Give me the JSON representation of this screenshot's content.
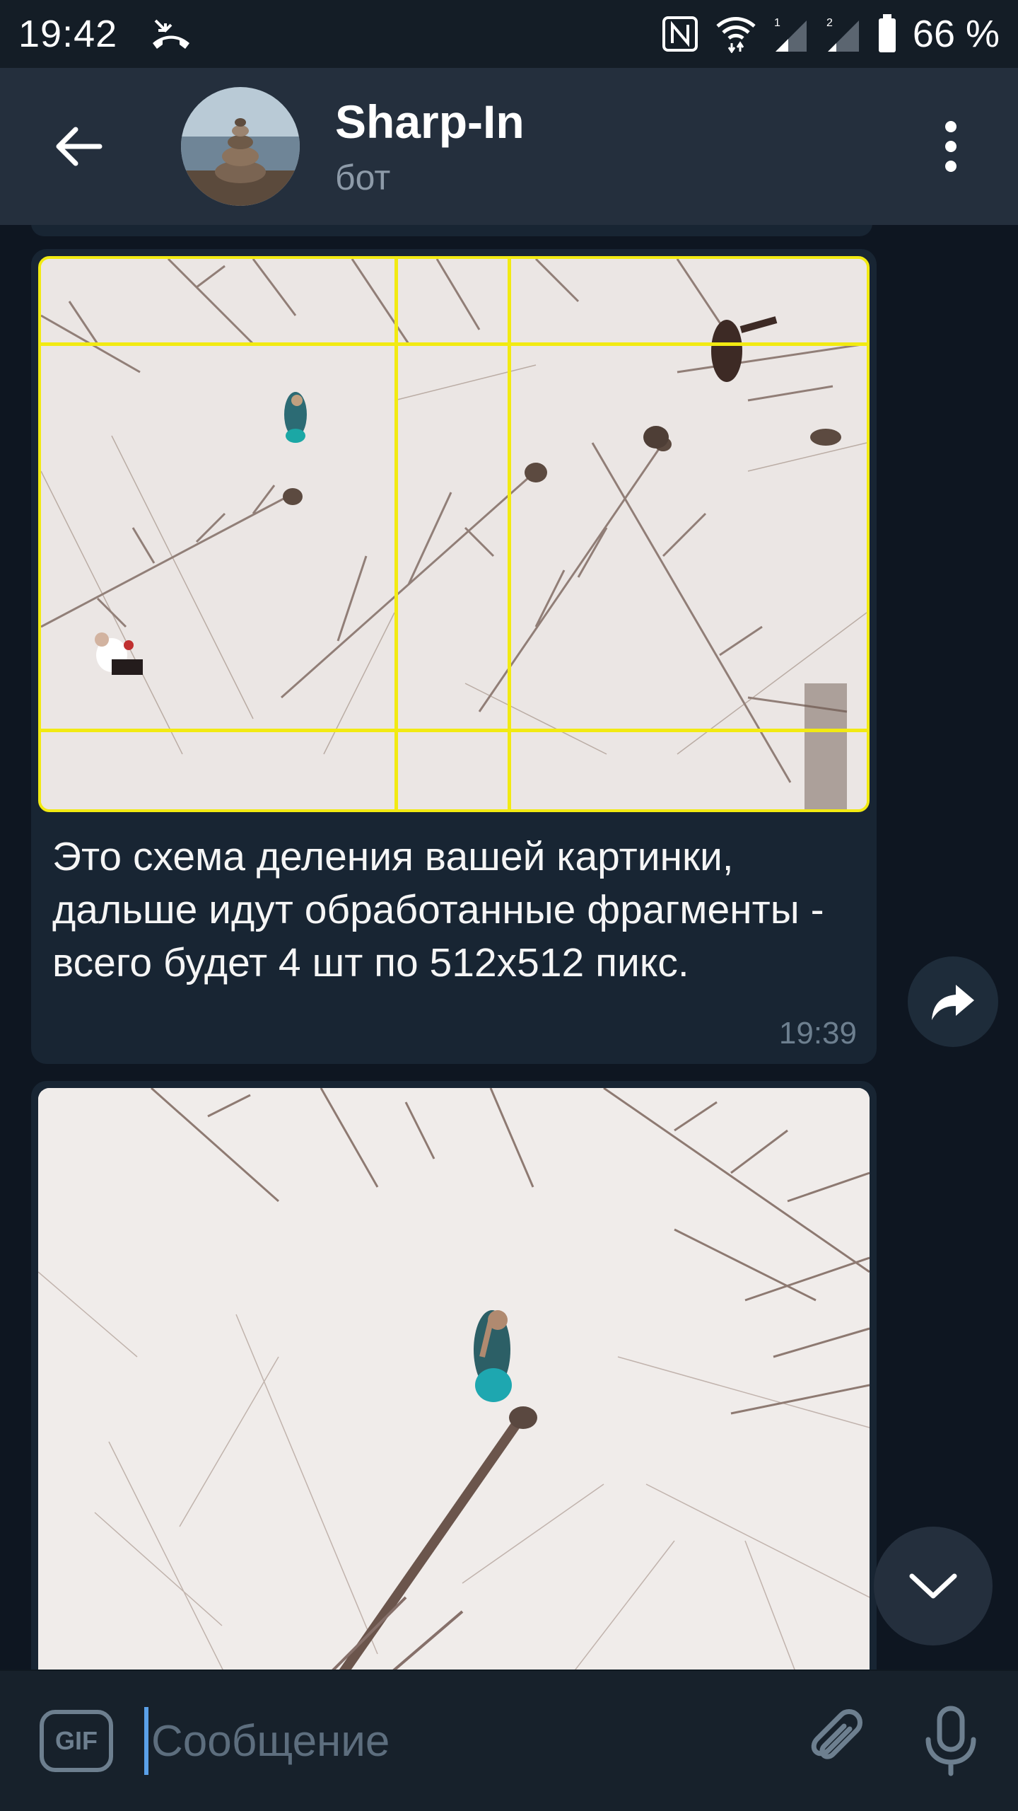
{
  "status_bar": {
    "time": "19:42",
    "battery_pct": "66 %",
    "icons": [
      "missed-call-icon",
      "nfc-icon",
      "wifi-icon",
      "signal-sim1-icon",
      "signal-sim2-icon",
      "battery-icon"
    ],
    "sim1_label": "1",
    "sim2_label": "2"
  },
  "header": {
    "title": "Sharp-In",
    "subtitle": "бот",
    "back_icon": "back-arrow-icon",
    "menu_icon": "more-vertical-icon"
  },
  "messages": [
    {
      "type": "photo_with_caption",
      "caption": "Это схема деления вашей картинки, дальше идут обработанные фрагменты - всего будет 4 шт по 512x512 пикс.",
      "time": "19:39",
      "grid_color": "#f2ea12"
    },
    {
      "type": "photo"
    }
  ],
  "share_icon": "share-icon",
  "scroll_down_icon": "chevron-down-icon",
  "input": {
    "gif_label": "GIF",
    "placeholder": "Сообщение",
    "attach_icon": "paperclip-icon",
    "mic_icon": "microphone-icon"
  },
  "colors": {
    "header_bg": "#242f3d",
    "chat_bg": "#0e1621",
    "bubble_bg": "#182533",
    "accent": "#5aa0e8"
  }
}
